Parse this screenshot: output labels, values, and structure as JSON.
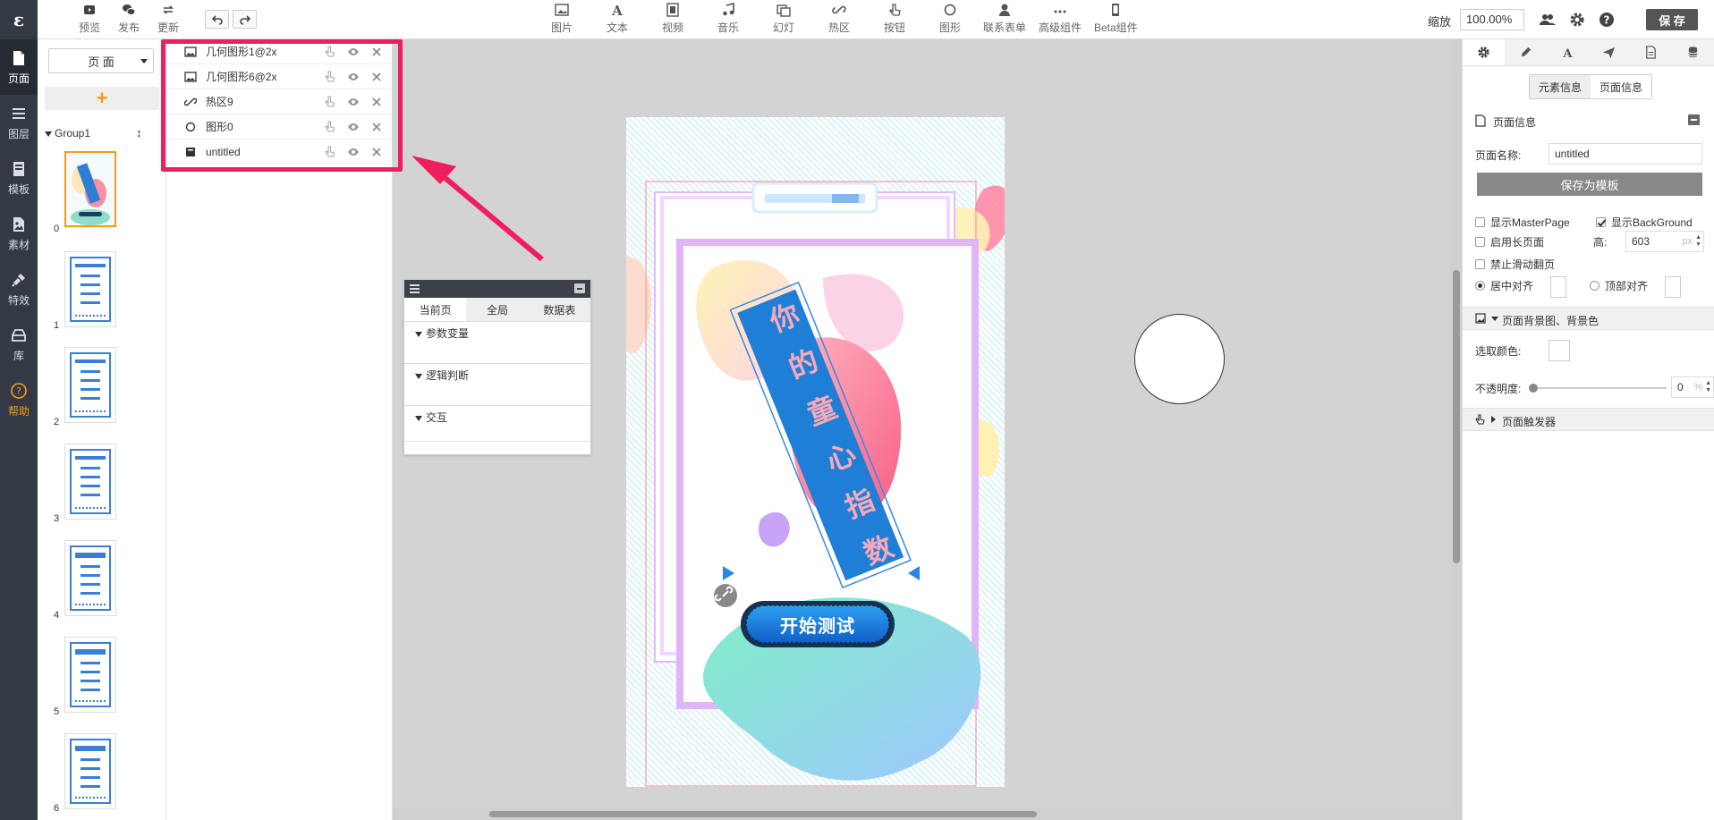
{
  "rail": {
    "logo": "ɛ",
    "items": [
      {
        "label": "页面",
        "icon": "page-icon"
      },
      {
        "label": "图层",
        "icon": "layers-icon"
      },
      {
        "label": "模板",
        "icon": "template-icon"
      },
      {
        "label": "素材",
        "icon": "image-icon"
      },
      {
        "label": "特效",
        "icon": "plug-icon"
      },
      {
        "label": "库",
        "icon": "library-icon"
      },
      {
        "label": "帮助",
        "icon": "help-icon"
      }
    ]
  },
  "toolbar": {
    "preview": "预览",
    "publish": "发布",
    "update": "更新",
    "insert": [
      "图片",
      "文本",
      "视频",
      "音乐",
      "幻灯",
      "热区",
      "按钮",
      "图形",
      "联系表单",
      "高级组件",
      "Beta组件"
    ],
    "zoom_label": "缩放",
    "zoom_value": "100.00%",
    "save": "保 存"
  },
  "pages": {
    "selector": "页 面",
    "add": "+",
    "group": "Group1",
    "sort_icon": "↕",
    "numbers": [
      "0",
      "1",
      "2",
      "3",
      "4",
      "5",
      "6"
    ]
  },
  "layers": [
    {
      "name": "几何图形1@2x",
      "icon": "image-icon"
    },
    {
      "name": "几何图形6@2x",
      "icon": "image-icon"
    },
    {
      "name": "热区9",
      "icon": "link-icon"
    },
    {
      "name": "图形0",
      "icon": "circle-icon"
    },
    {
      "name": "untitled",
      "icon": "archive-icon"
    }
  ],
  "interaction": {
    "tabs": [
      "当前页",
      "全局",
      "数据表"
    ],
    "sections": [
      "参数变量",
      "逻辑判断",
      "交互"
    ]
  },
  "canvas": {
    "title_chars": [
      "你",
      "的",
      "童",
      "心",
      "指",
      "数"
    ],
    "start_button": "开始测试"
  },
  "right": {
    "seg": [
      "元素信息",
      "页面信息"
    ],
    "section_title": "页面信息",
    "page_name_label": "页面名称:",
    "page_name_value": "untitled",
    "save_template": "保存为模板",
    "show_masterpage": "显示MasterPage",
    "show_background": "显示BackGround",
    "long_page": "启用长页面",
    "height_label": "高:",
    "height_value": "603",
    "height_unit": "px",
    "no_swipe": "禁止滑动翻页",
    "center_align": "居中对齐",
    "top_align": "顶部对齐",
    "bg_section": "页面背景图、背景色",
    "pick_color": "选取颜色:",
    "opacity_label": "不透明度:",
    "opacity_value": "0",
    "opacity_unit": "%",
    "trigger_section": "页面触发器"
  }
}
